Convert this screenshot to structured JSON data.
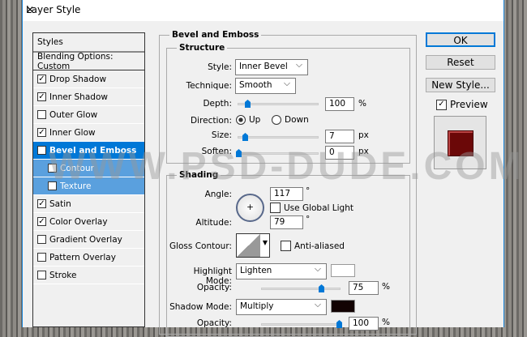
{
  "title": "Layer Style",
  "left": {
    "header": "Styles",
    "blending": "Blending Options: Custom",
    "items": [
      {
        "label": "Drop Shadow",
        "checked": true
      },
      {
        "label": "Inner Shadow",
        "checked": true
      },
      {
        "label": "Outer Glow",
        "checked": false
      },
      {
        "label": "Inner Glow",
        "checked": true
      },
      {
        "label": "Bevel and Emboss",
        "checked": true
      },
      {
        "label": "Contour",
        "checked": false
      },
      {
        "label": "Texture",
        "checked": false
      },
      {
        "label": "Satin",
        "checked": true
      },
      {
        "label": "Color Overlay",
        "checked": true
      },
      {
        "label": "Gradient Overlay",
        "checked": false
      },
      {
        "label": "Pattern Overlay",
        "checked": false
      },
      {
        "label": "Stroke",
        "checked": false
      }
    ]
  },
  "bevel": {
    "title": "Bevel and Emboss",
    "structure": "Structure",
    "style_label": "Style:",
    "style": "Inner Bevel",
    "technique_label": "Technique:",
    "technique": "Smooth",
    "depth_label": "Depth:",
    "depth": "100",
    "pct": "%",
    "direction_label": "Direction:",
    "up": "Up",
    "down": "Down",
    "size_label": "Size:",
    "size": "7",
    "px": "px",
    "soften_label": "Soften:",
    "soften": "0"
  },
  "shading": {
    "title": "Shading",
    "angle_label": "Angle:",
    "angle": "117",
    "deg": "°",
    "global": "Use Global Light",
    "altitude_label": "Altitude:",
    "altitude": "79",
    "gloss_label": "Gloss Contour:",
    "anti": "Anti-aliased",
    "hl_label": "Highlight Mode:",
    "hl": "Lighten",
    "op_label": "Opacity:",
    "hl_op": "75",
    "sh_label": "Shadow Mode:",
    "sh": "Multiply",
    "sh_op": "100",
    "hl_color": "#ffffff",
    "sh_color": "#120202"
  },
  "buttons": {
    "ok": "OK",
    "reset": "Reset",
    "new_style": "New Style...",
    "preview": "Preview"
  },
  "watermark": "WWW.PSD-DUDE.COM"
}
